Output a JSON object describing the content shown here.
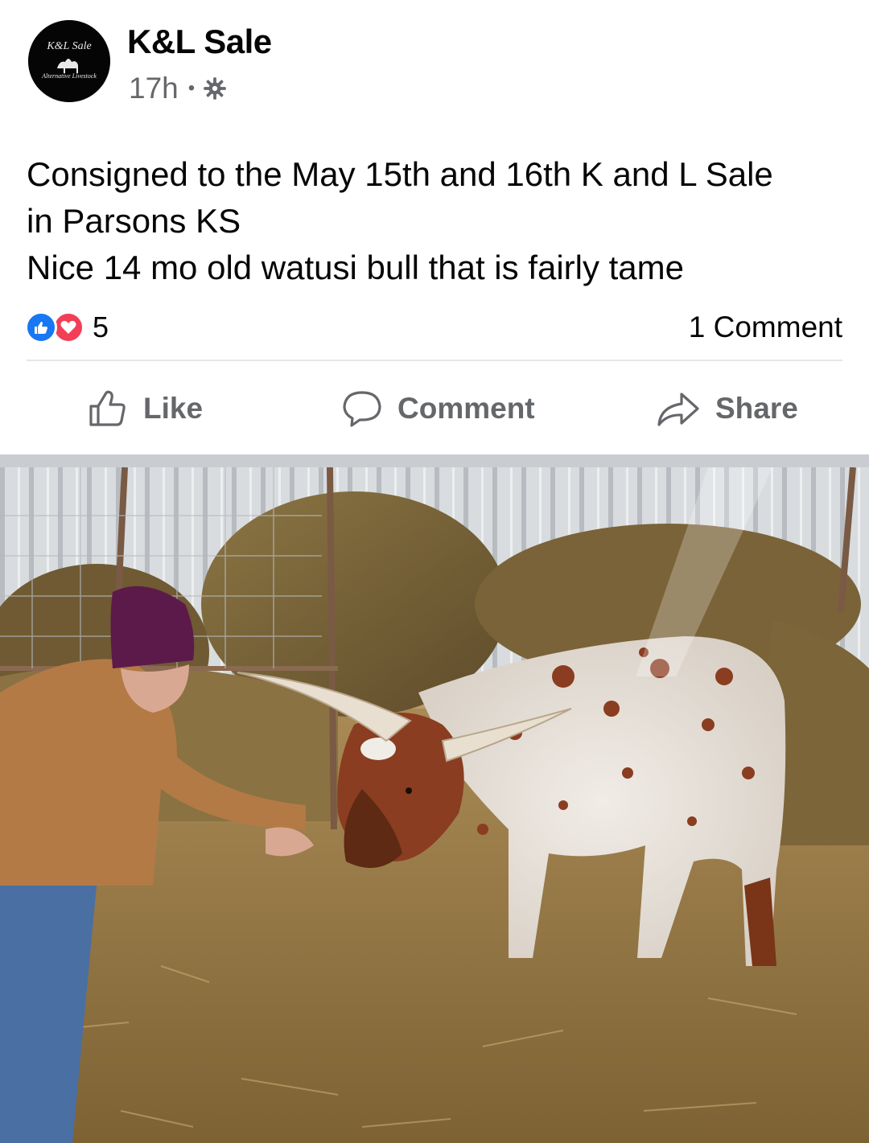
{
  "post": {
    "author": "K&L Sale",
    "avatar_logo_text": [
      "K&L Sale",
      "Alternative Livestock"
    ],
    "time": "17h",
    "separator": "•",
    "privacy_icon": "gear-icon",
    "text_lines": [
      "Consigned to the May 15th and 16th K and L Sale",
      "in Parsons KS",
      "Nice 14 mo old watusi bull that is fairly tame"
    ]
  },
  "reactions": {
    "icons": [
      "like-reaction-icon",
      "love-reaction-icon"
    ],
    "count": "5",
    "comments": "1 Comment"
  },
  "actions": {
    "like": "Like",
    "comment": "Comment",
    "share": "Share"
  },
  "photo": {
    "subject": "watusi-bull-photo"
  },
  "colors": {
    "meta_gray": "#65676b",
    "like_blue": "#1877f2",
    "love_red": "#f33e58",
    "divider": "#e4e6eb"
  }
}
